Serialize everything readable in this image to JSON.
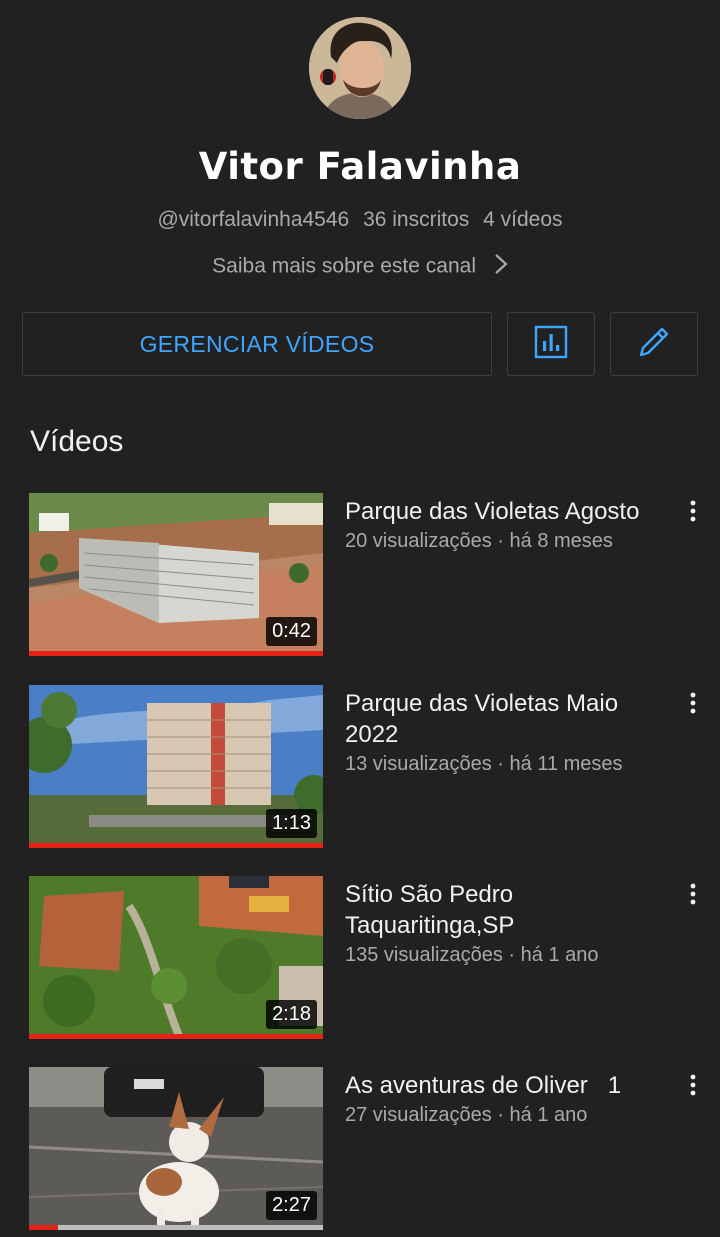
{
  "channel": {
    "name": "Vitor Falavinha",
    "handle": "@vitorfalavinha4546",
    "subscribers": "36 inscritos",
    "video_count": "4 vídeos",
    "about_link": "Saiba mais sobre este canal"
  },
  "actions": {
    "manage_label": "GERENCIAR VÍDEOS",
    "stats_icon": "bar-chart-icon",
    "edit_icon": "pencil-icon",
    "accent": "#3ea6ff"
  },
  "section": {
    "title": "Vídeos"
  },
  "videos": [
    {
      "title": "Parque das Violetas Agosto",
      "meta": "20 visualizações · há 8 meses",
      "duration": "0:42",
      "watched": 1.0
    },
    {
      "title": "Parque das Violetas Maio 2022",
      "meta": "13 visualizações · há 11 meses",
      "duration": "1:13",
      "watched": 1.0
    },
    {
      "title": "Sítio São Pedro Taquaritinga,SP",
      "meta": "135 visualizações · há 1 ano",
      "duration": "2:18",
      "watched": 1.0
    },
    {
      "title": "As aventuras de Oliver   1",
      "meta": "27 visualizações · há 1 ano",
      "duration": "2:27",
      "watched": 0.1
    }
  ],
  "colors": {
    "background": "#212121",
    "progress": "#e62117",
    "secondary_text": "#aaaaaa"
  }
}
